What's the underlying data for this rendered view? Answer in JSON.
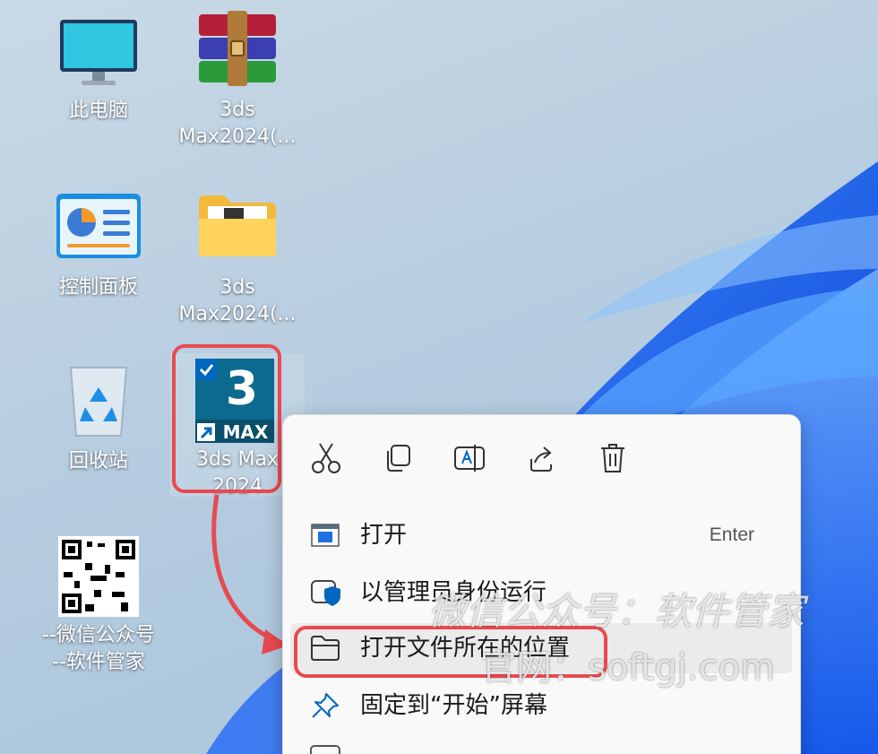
{
  "desktop": {
    "icons": [
      {
        "name": "this-pc",
        "line1": "此电脑",
        "line2": ""
      },
      {
        "name": "winrar-archive",
        "line1": "3ds",
        "line2": "Max2024(..."
      },
      {
        "name": "control-panel",
        "line1": "控制面板",
        "line2": ""
      },
      {
        "name": "folder",
        "line1": "3ds",
        "line2": "Max2024(..."
      },
      {
        "name": "recycle-bin",
        "line1": "回收站",
        "line2": ""
      },
      {
        "name": "3dsmax-shortcut",
        "line1": "3ds Max",
        "line2": "2024"
      },
      {
        "name": "qr-code",
        "line1": "--微信公众号",
        "line2": "--软件管家"
      }
    ],
    "max_icon_text": "3",
    "max_badge_text": "MAX"
  },
  "context_menu": {
    "items": [
      {
        "label": "打开",
        "shortcut": "Enter"
      },
      {
        "label": "以管理员身份运行",
        "shortcut": ""
      },
      {
        "label": "打开文件所在的位置",
        "shortcut": ""
      },
      {
        "label": "固定到“开始”屏幕",
        "shortcut": ""
      }
    ]
  },
  "watermark": {
    "line1": "微信公众号：软件管家",
    "line2": "官网：softgj.com"
  },
  "colors": {
    "highlight": "#e84a4f",
    "accent": "#0067c0"
  }
}
